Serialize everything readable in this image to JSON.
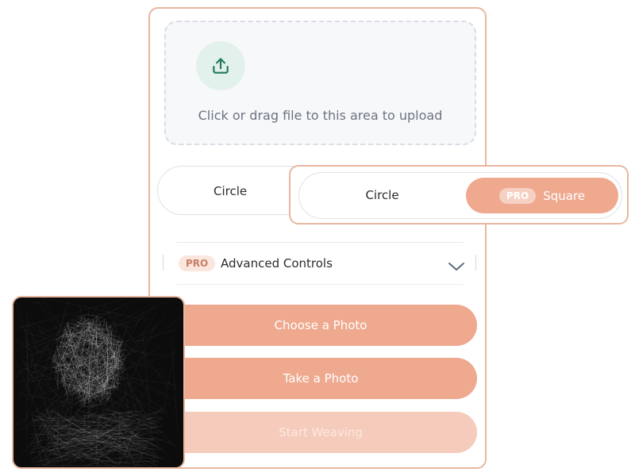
{
  "upload": {
    "icon": "upload-icon",
    "text": "Click or drag file to this area to upload"
  },
  "shape_selector": {
    "options": [
      "Circle",
      "Square"
    ],
    "selected": "Square",
    "pro_badge": "PRO"
  },
  "advanced": {
    "pro_badge": "PRO",
    "label": "Advanced Controls",
    "icon": "chevron-down-icon"
  },
  "actions": {
    "choose_photo": "Choose a Photo",
    "take_photo": "Take a Photo",
    "start_weaving": "Start Weaving"
  },
  "preview": {
    "description_icon": "string-art-portrait"
  },
  "colors": {
    "accent": "#eea98f",
    "accent_disabled": "#f5cbbb",
    "border_accent": "#e8b79f",
    "upload_icon": "#1f7a5a"
  }
}
